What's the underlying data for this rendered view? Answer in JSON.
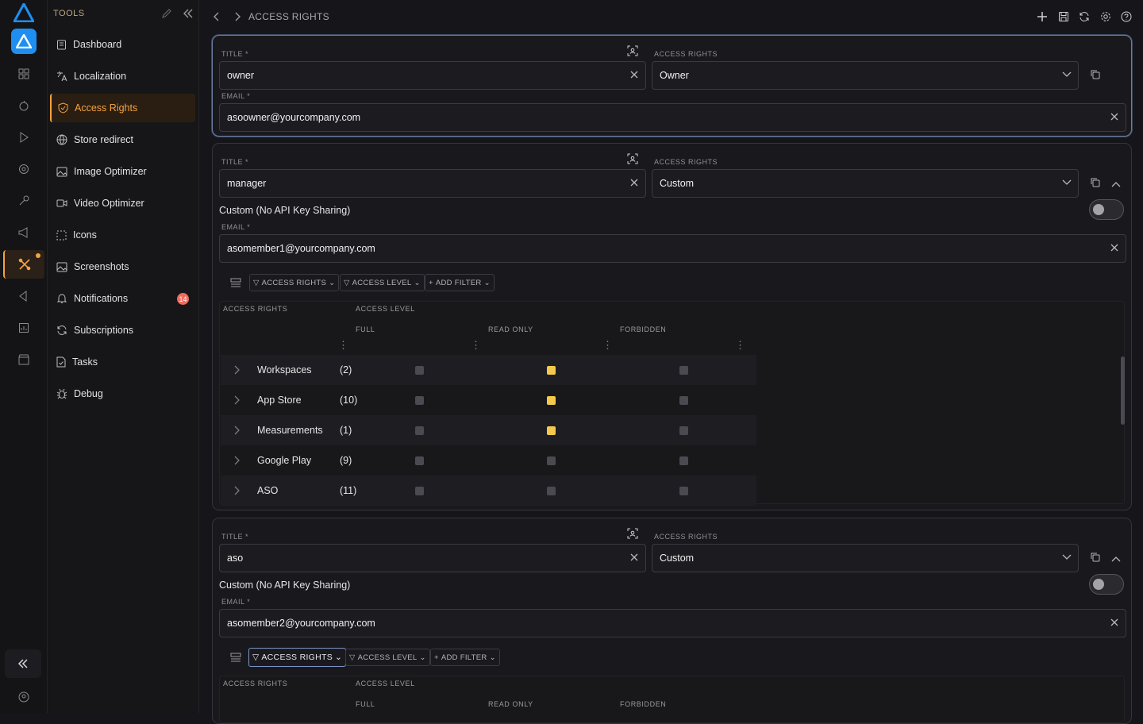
{
  "sidebar": {
    "header": "TOOLS",
    "items": [
      {
        "label": "Dashboard",
        "icon": "clipboard-icon"
      },
      {
        "label": "Localization",
        "icon": "translate-icon"
      },
      {
        "label": "Access Rights",
        "icon": "shield-icon"
      },
      {
        "label": "Store redirect",
        "icon": "globe-icon"
      },
      {
        "label": "Image Optimizer",
        "icon": "image-icon"
      },
      {
        "label": "Video Optimizer",
        "icon": "video-icon"
      },
      {
        "label": "Icons",
        "icon": "icon-frame-icon"
      },
      {
        "label": "Screenshots",
        "icon": "image-icon"
      },
      {
        "label": "Notifications",
        "icon": "bell-icon",
        "badge": "14"
      },
      {
        "label": "Subscriptions",
        "icon": "refresh-icon"
      },
      {
        "label": "Tasks",
        "icon": "file-check-icon"
      },
      {
        "label": "Debug",
        "icon": "bug-icon"
      }
    ]
  },
  "breadcrumb": "ACCESS RIGHTS",
  "colors": {
    "accent": "#f4a340",
    "checked": "#f2c94c",
    "badge": "#f06b5d",
    "app": "#1e8ef0"
  },
  "labels": {
    "title": "TITLE",
    "access_rights": "ACCESS RIGHTS",
    "email": "EMAIL",
    "required": "*",
    "custom_toggle": "Custom (No API Key Sharing)",
    "filter_access_rights": "ACCESS RIGHTS",
    "filter_access_level": "ACCESS LEVEL",
    "filter_add": "ADD FILTER",
    "col_access_rights": "ACCESS RIGHTS",
    "col_access_level": "ACCESS LEVEL",
    "col_full": "FULL",
    "col_read_only": "READ ONLY",
    "col_forbidden": "FORBIDDEN"
  },
  "members": [
    {
      "title": "owner",
      "access": "Owner",
      "email": "asoowner@yourcompany.com"
    },
    {
      "title": "manager",
      "access": "Custom",
      "email": "asomember1@yourcompany.com"
    },
    {
      "title": "aso",
      "access": "Custom",
      "email": "asomember2@yourcompany.com"
    }
  ],
  "rights_rows": [
    {
      "name": "Workspaces",
      "count": "(2)",
      "level": "read_only"
    },
    {
      "name": "App Store",
      "count": "(10)",
      "level": "read_only"
    },
    {
      "name": "Measurements",
      "count": "(1)",
      "level": "read_only"
    },
    {
      "name": "Google Play",
      "count": "(9)",
      "level": "none"
    },
    {
      "name": "ASO",
      "count": "(11)",
      "level": "none"
    }
  ]
}
